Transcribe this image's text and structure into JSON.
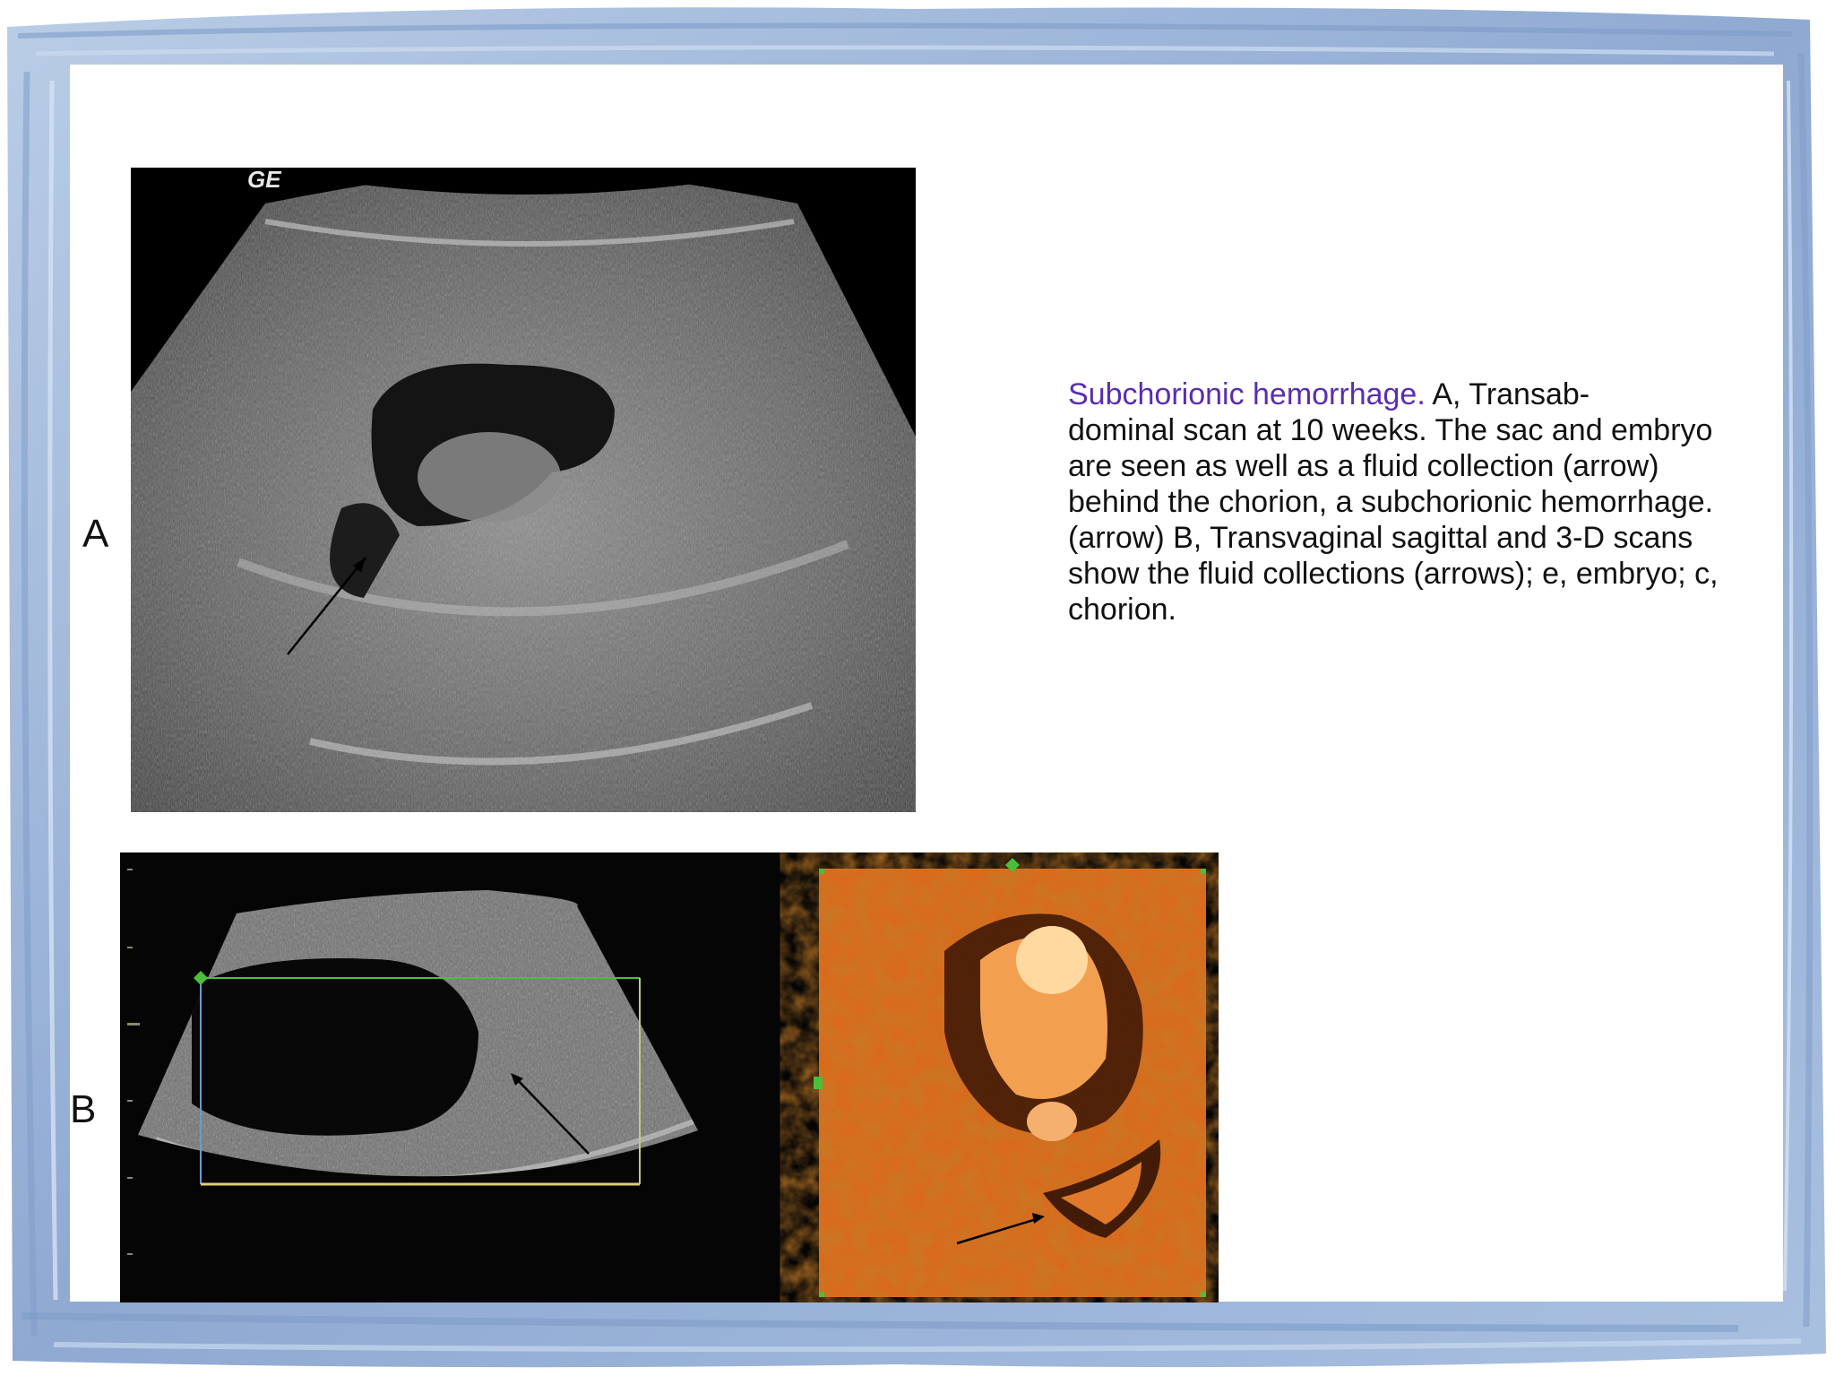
{
  "slide": {
    "label_a": "A",
    "label_b": "B",
    "caption_head": "Subchorionic hemorrhage.",
    "caption_lines": [
      " A, Transab-",
      "dominal scan at 10 weeks. The sac and embryo",
      "are seen as well as a fluid collection (arrow)",
      "behind the chorion, a subchorionic hemorrhage.",
      "(arrow) B, Transvaginal sagittal and 3-D scans",
      "show the fluid collections (arrows); e, embryo; c,",
      "chorion."
    ],
    "ultrasound_a_watermark": "GE"
  },
  "colors": {
    "frame": "#9fb8da",
    "frame_dark": "#7f9cc8",
    "caption_accent": "#5a2db0",
    "render_3d": "#d96a1c",
    "roi_green": "#4bbf3a",
    "roi_yellow": "#e0d070"
  }
}
